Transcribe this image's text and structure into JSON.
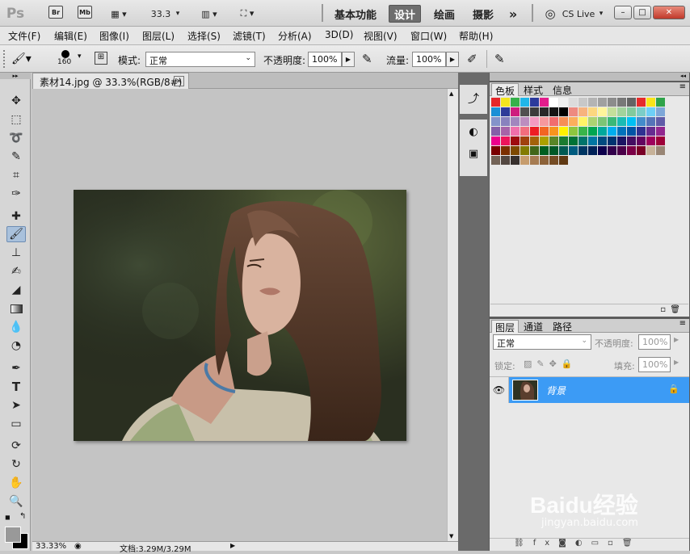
{
  "titlebar": {
    "logo": "Ps",
    "br": "Br",
    "mb": "Mb",
    "zoom": "33.3",
    "workspaces": [
      "基本功能",
      "设计",
      "绘画",
      "摄影"
    ],
    "active_ws": "设计",
    "more": "»",
    "cslive": "CS Live",
    "win_min": "–",
    "win_max": "□",
    "win_close": "✕"
  },
  "menu": [
    "文件(F)",
    "编辑(E)",
    "图像(I)",
    "图层(L)",
    "选择(S)",
    "滤镜(T)",
    "分析(A)",
    "3D(D)",
    "视图(V)",
    "窗口(W)",
    "帮助(H)"
  ],
  "options": {
    "brush_size": "160",
    "mode_label": "模式:",
    "mode_value": "正常",
    "opacity_label": "不透明度:",
    "opacity_value": "100%",
    "flow_label": "流量:",
    "flow_value": "100%"
  },
  "document": {
    "tab_title": "素材14.jpg @ 33.3%(RGB/8#)",
    "close": "✕"
  },
  "status": {
    "zoom": "33.33%",
    "doc_info": "文档:3.29M/3.29M"
  },
  "swatches_panel": {
    "tabs": [
      "色板",
      "样式",
      "信息"
    ]
  },
  "layers_panel": {
    "tabs": [
      "图层",
      "通道",
      "路径"
    ],
    "blend_mode": "正常",
    "opacity_label": "不透明度:",
    "opacity_value": "100%",
    "lock_label": "锁定:",
    "fill_label": "填充:",
    "fill_value": "100%",
    "layer_name": "背景"
  },
  "watermark": {
    "brand": "Baidu经验",
    "url": "jingyan.baidu.com"
  },
  "colors": {
    "accent_selected": "#3c9bf5",
    "photo_bg": "#2b3020"
  },
  "icons": {
    "tools": [
      "move-icon",
      "marquee-icon",
      "lasso-icon",
      "quick-select-icon",
      "crop-icon",
      "eyedropper-icon",
      "healing-icon",
      "brush-icon",
      "stamp-icon",
      "history-brush-icon",
      "eraser-icon",
      "gradient-icon",
      "blur-icon",
      "dodge-icon",
      "pen-icon",
      "type-icon",
      "path-select-icon",
      "shape-icon",
      "3d-rotate-icon",
      "3d-orbit-icon",
      "hand-icon",
      "zoom-icon"
    ]
  }
}
